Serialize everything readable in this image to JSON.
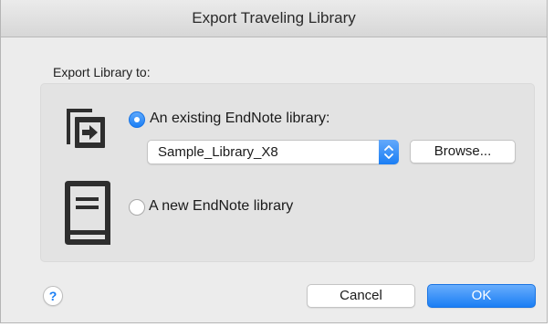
{
  "window": {
    "title": "Export Traveling Library"
  },
  "export": {
    "section_label": "Export Library to:",
    "options": [
      {
        "label": "An existing EndNote library:",
        "selected": true,
        "icon": "export-to-library-icon"
      },
      {
        "label": "A new EndNote library",
        "selected": false,
        "icon": "book-icon"
      }
    ],
    "library_select": {
      "value": "Sample_Library_X8"
    },
    "browse_label": "Browse..."
  },
  "footer": {
    "help_label": "?",
    "cancel_label": "Cancel",
    "ok_label": "OK"
  },
  "colors": {
    "accent": "#1a7ef4",
    "icon": "#2e2e2e",
    "dialog_bg": "#ececec",
    "group_bg": "#e3e3e3"
  }
}
